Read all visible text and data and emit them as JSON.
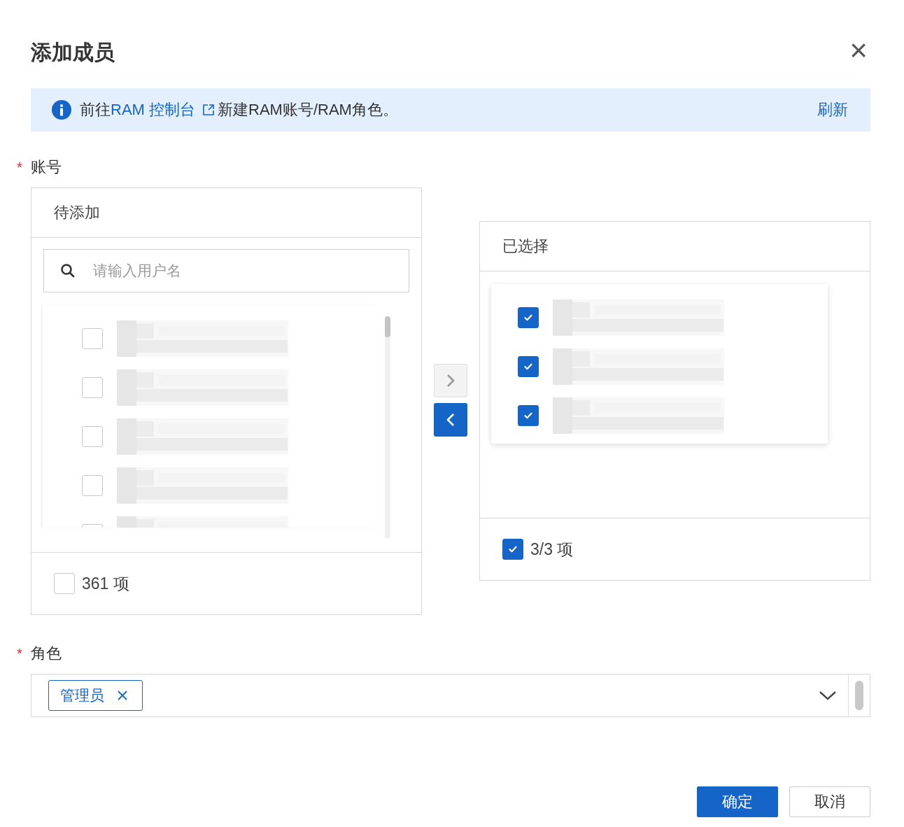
{
  "dialog": {
    "title": "添加成员",
    "close": "×"
  },
  "notice": {
    "prefix": "前往",
    "link": "RAM 控制台",
    "suffix": "新建RAM账号/RAM角色。",
    "action": "刷新"
  },
  "account": {
    "label": "账号",
    "required_mark": "*",
    "source": {
      "title": "待添加",
      "search": {
        "placeholder": "请输入用户名"
      },
      "items": [
        {
          "checked": false
        },
        {
          "checked": false
        },
        {
          "checked": false
        },
        {
          "checked": false
        },
        {
          "checked": false
        }
      ],
      "footer": {
        "checked": false,
        "count": "361 项"
      }
    },
    "transfer": [
      {
        "kind": "right",
        "disabled": true
      },
      {
        "kind": "left",
        "disabled": false
      }
    ],
    "target": {
      "title": "已选择",
      "items": [
        {
          "checked": true
        },
        {
          "checked": true
        },
        {
          "checked": true
        }
      ],
      "footer": {
        "checked": true,
        "count": "3/3 项"
      }
    }
  },
  "role": {
    "label": "角色",
    "required_mark": "*",
    "tags": [
      {
        "text": "管理员"
      }
    ]
  },
  "buttons": [
    {
      "text": "确定",
      "primary": true
    },
    {
      "text": "取消",
      "primary": false
    }
  ]
}
